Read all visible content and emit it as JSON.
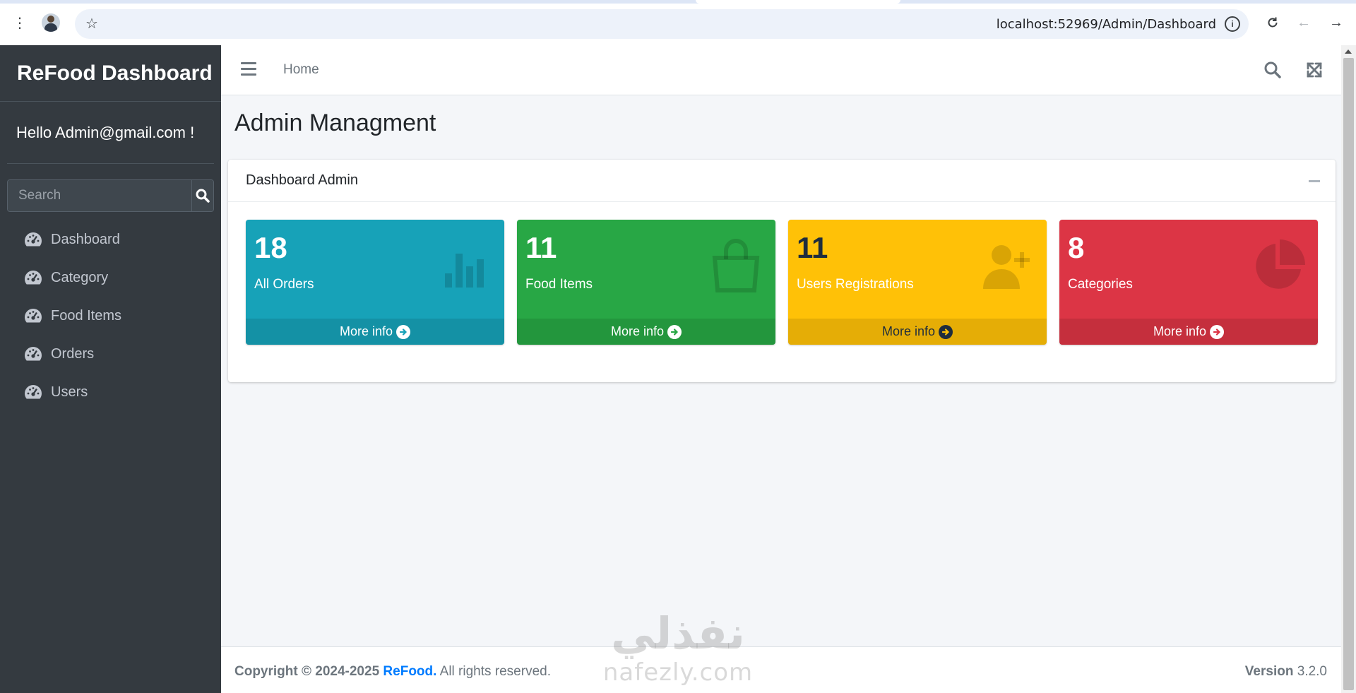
{
  "browser": {
    "url": "localhost:52969/Admin/Dashboard"
  },
  "sidebar": {
    "brand": "ReFood Dashboard",
    "greeting": "Hello Admin@gmail.com !",
    "search_placeholder": "Search",
    "items": [
      {
        "label": "Dashboard"
      },
      {
        "label": "Category"
      },
      {
        "label": "Food Items"
      },
      {
        "label": "Orders"
      },
      {
        "label": "Users"
      }
    ]
  },
  "navbar": {
    "home_label": "Home"
  },
  "page": {
    "title": "Admin Managment",
    "card_title": "Dashboard Admin"
  },
  "stats": [
    {
      "value": "18",
      "label": "All Orders",
      "link": "More info",
      "color": "#17a2b8",
      "icon": "bar-chart-icon"
    },
    {
      "value": "11",
      "label": "Food Items",
      "link": "More info",
      "color": "#28a745",
      "icon": "shopping-bag-icon"
    },
    {
      "value": "11",
      "label": "Users Registrations",
      "link": "More info",
      "color": "#ffc107",
      "icon": "user-plus-icon"
    },
    {
      "value": "8",
      "label": "Categories",
      "link": "More info",
      "color": "#dc3545",
      "icon": "pie-chart-icon"
    }
  ],
  "footer": {
    "copyright_prefix": "Copyright © 2024-2025",
    "brand_link": "ReFood.",
    "rights": "All rights reserved.",
    "version_label": "Version",
    "version_value": "3.2.0"
  },
  "watermark": {
    "arabic": "نفذلي",
    "latin": "nafezly.com"
  }
}
